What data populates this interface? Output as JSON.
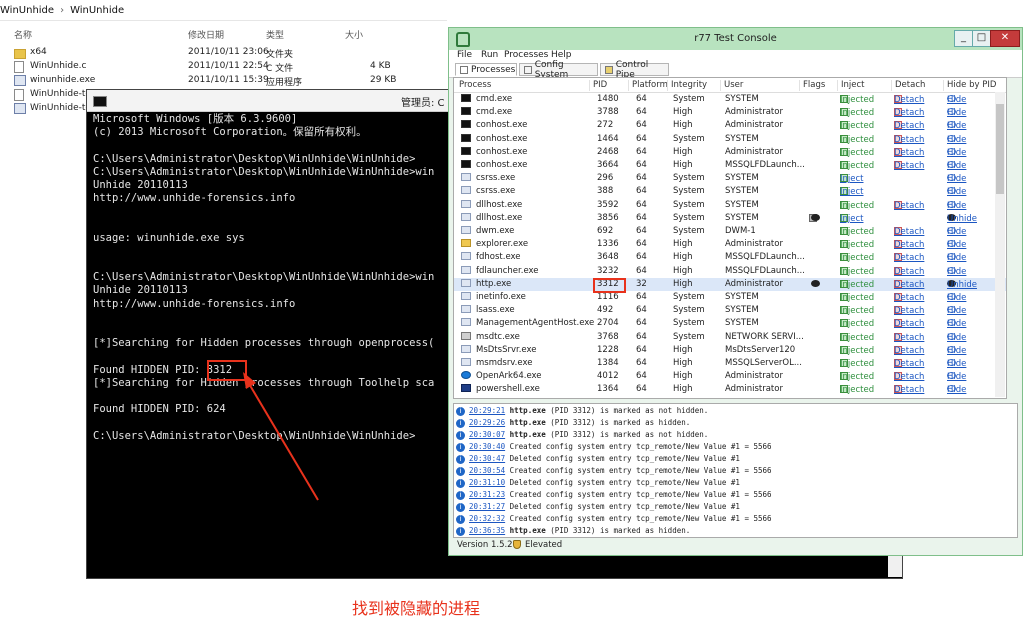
{
  "explorer": {
    "breadcrumb": [
      "WinUnhide",
      "WinUnhide"
    ],
    "columns": {
      "name": "名称",
      "modified": "修改日期",
      "type": "类型",
      "size": "大小"
    },
    "files": [
      {
        "name": "x64",
        "modified": "2011/10/11 23:06",
        "type": "文件夹",
        "size": "",
        "icon": "folder-icon"
      },
      {
        "name": "WinUnhide.c",
        "modified": "2011/10/11 22:54",
        "type": "C 文件",
        "size": "4 KB",
        "icon": "file-icon"
      },
      {
        "name": "winunhide.exe",
        "modified": "2011/10/11 15:39",
        "type": "应用程序",
        "size": "29 KB",
        "icon": "exe-icon"
      },
      {
        "name": "WinUnhide-tcp",
        "modified": "",
        "type": "",
        "size": "",
        "icon": "file-icon"
      },
      {
        "name": "WinUnhide-tcp",
        "modified": "",
        "type": "",
        "size": "",
        "icon": "exe-icon"
      }
    ]
  },
  "cmd": {
    "title": "管理员: C",
    "lines": [
      "Microsoft Windows [版本 6.3.9600]",
      "(c) 2013 Microsoft Corporation。保留所有权利。",
      "",
      "C:\\Users\\Administrator\\Desktop\\WinUnhide\\WinUnhide>",
      "C:\\Users\\Administrator\\Desktop\\WinUnhide\\WinUnhide>win",
      "Unhide 20110113",
      "http://www.unhide-forensics.info",
      "",
      "",
      "usage: winunhide.exe sys",
      "",
      "",
      "C:\\Users\\Administrator\\Desktop\\WinUnhide\\WinUnhide>win",
      "Unhide 20110113",
      "http://www.unhide-forensics.info",
      "",
      "",
      "[*]Searching for Hidden processes through openprocess(",
      "",
      "Found HIDDEN PID: 3312",
      "[*]Searching for Hidden processes through Toolhelp sca",
      "",
      "Found HIDDEN PID: 624",
      "",
      "C:\\Users\\Administrator\\Desktop\\WinUnhide\\WinUnhide>"
    ],
    "annotation": "找到被隐藏的进程"
  },
  "r77": {
    "title": "r77 Test Console",
    "controls": {
      "minimize": "_",
      "maximize": "□",
      "close": "✕"
    },
    "menu": [
      "File",
      "Run",
      "Processes",
      "Help"
    ],
    "tabs": [
      "Processes",
      "Config System",
      "Control Pipe"
    ],
    "columns": {
      "process": "Process",
      "pid": "PID",
      "platform": "Platform",
      "integrity": "Integrity",
      "user": "User",
      "flags": "Flags",
      "inject": "Inject",
      "detach": "Detach",
      "hide": "Hide by PID"
    },
    "processes": [
      {
        "name": "cmd.exe",
        "pid": "1480",
        "platform": "64",
        "integrity": "System",
        "user": "SYSTEM",
        "inject": "Injected",
        "detach": "Detach",
        "hide": "Hide",
        "icon": "cmd"
      },
      {
        "name": "cmd.exe",
        "pid": "3788",
        "platform": "64",
        "integrity": "High",
        "user": "Administrator",
        "inject": "Injected",
        "detach": "Detach",
        "hide": "Hide",
        "icon": "cmd"
      },
      {
        "name": "conhost.exe",
        "pid": "272",
        "platform": "64",
        "integrity": "High",
        "user": "Administrator",
        "inject": "Injected",
        "detach": "Detach",
        "hide": "Hide",
        "icon": "cmd"
      },
      {
        "name": "conhost.exe",
        "pid": "1464",
        "platform": "64",
        "integrity": "System",
        "user": "SYSTEM",
        "inject": "Injected",
        "detach": "Detach",
        "hide": "Hide",
        "icon": "cmd"
      },
      {
        "name": "conhost.exe",
        "pid": "2468",
        "platform": "64",
        "integrity": "High",
        "user": "Administrator",
        "inject": "Injected",
        "detach": "Detach",
        "hide": "Hide",
        "icon": "cmd"
      },
      {
        "name": "conhost.exe",
        "pid": "3664",
        "platform": "64",
        "integrity": "High",
        "user": "MSSQLFDLaunch...",
        "inject": "Injected",
        "detach": "Detach",
        "hide": "Hide",
        "icon": "cmd"
      },
      {
        "name": "csrss.exe",
        "pid": "296",
        "platform": "64",
        "integrity": "System",
        "user": "SYSTEM",
        "inject": "Inject",
        "detach": "",
        "hide": "Hide",
        "icon": "gen"
      },
      {
        "name": "csrss.exe",
        "pid": "388",
        "platform": "64",
        "integrity": "System",
        "user": "SYSTEM",
        "inject": "Inject",
        "detach": "",
        "hide": "Hide",
        "icon": "gen"
      },
      {
        "name": "dllhost.exe",
        "pid": "3592",
        "platform": "64",
        "integrity": "System",
        "user": "SYSTEM",
        "inject": "Injected",
        "detach": "Detach",
        "hide": "Hide",
        "icon": "gen"
      },
      {
        "name": "dllhost.exe",
        "pid": "3856",
        "platform": "64",
        "integrity": "System",
        "user": "SYSTEM",
        "inject": "Inject",
        "detach": "",
        "hide": "Unhide",
        "icon": "gen",
        "flags": true
      },
      {
        "name": "dwm.exe",
        "pid": "692",
        "platform": "64",
        "integrity": "System",
        "user": "DWM-1",
        "inject": "Injected",
        "detach": "Detach",
        "hide": "Hide",
        "icon": "gen"
      },
      {
        "name": "explorer.exe",
        "pid": "1336",
        "platform": "64",
        "integrity": "High",
        "user": "Administrator",
        "inject": "Injected",
        "detach": "Detach",
        "hide": "Hide",
        "icon": "exp"
      },
      {
        "name": "fdhost.exe",
        "pid": "3648",
        "platform": "64",
        "integrity": "High",
        "user": "MSSQLFDLaunch...",
        "inject": "Injected",
        "detach": "Detach",
        "hide": "Hide",
        "icon": "gen"
      },
      {
        "name": "fdlauncher.exe",
        "pid": "3232",
        "platform": "64",
        "integrity": "High",
        "user": "MSSQLFDLaunch...",
        "inject": "Injected",
        "detach": "Detach",
        "hide": "Hide",
        "icon": "gen"
      },
      {
        "name": "http.exe",
        "pid": "3312",
        "platform": "32",
        "integrity": "High",
        "user": "Administrator",
        "inject": "Injected",
        "detach": "Detach",
        "hide": "Unhide",
        "icon": "gen",
        "flags": true,
        "selected": true
      },
      {
        "name": "inetinfo.exe",
        "pid": "1116",
        "platform": "64",
        "integrity": "System",
        "user": "SYSTEM",
        "inject": "Injected",
        "detach": "Detach",
        "hide": "Hide",
        "icon": "gen"
      },
      {
        "name": "lsass.exe",
        "pid": "492",
        "platform": "64",
        "integrity": "System",
        "user": "SYSTEM",
        "inject": "Injected",
        "detach": "Detach",
        "hide": "Hide",
        "icon": "gen"
      },
      {
        "name": "ManagementAgentHost.exe",
        "pid": "2704",
        "platform": "64",
        "integrity": "System",
        "user": "SYSTEM",
        "inject": "Injected",
        "detach": "Detach",
        "hide": "Hide",
        "icon": "gen"
      },
      {
        "name": "msdtc.exe",
        "pid": "3768",
        "platform": "64",
        "integrity": "System",
        "user": "NETWORK SERVI...",
        "inject": "Injected",
        "detach": "Detach",
        "hide": "Hide",
        "icon": "dtc"
      },
      {
        "name": "MsDtsSrvr.exe",
        "pid": "1228",
        "platform": "64",
        "integrity": "High",
        "user": "MsDtsServer120",
        "inject": "Injected",
        "detach": "Detach",
        "hide": "Hide",
        "icon": "gen"
      },
      {
        "name": "msmdsrv.exe",
        "pid": "1384",
        "platform": "64",
        "integrity": "High",
        "user": "MSSQLServerOL...",
        "inject": "Injected",
        "detach": "Detach",
        "hide": "Hide",
        "icon": "gen"
      },
      {
        "name": "OpenArk64.exe",
        "pid": "4012",
        "platform": "64",
        "integrity": "High",
        "user": "Administrator",
        "inject": "Injected",
        "detach": "Detach",
        "hide": "Hide",
        "icon": "oa"
      },
      {
        "name": "powershell.exe",
        "pid": "1364",
        "platform": "64",
        "integrity": "High",
        "user": "Administrator",
        "inject": "Injected",
        "detach": "Detach",
        "hide": "Hide",
        "icon": "ps"
      }
    ],
    "log": [
      {
        "time": "20:29:21",
        "bold": "http.exe",
        "text": " (PID 3312) is marked as not hidden."
      },
      {
        "time": "20:29:26",
        "bold": "http.exe",
        "text": " (PID 3312) is marked as hidden."
      },
      {
        "time": "20:30:07",
        "bold": "http.exe",
        "text": " (PID 3312) is marked as not hidden."
      },
      {
        "time": "20:30:40",
        "bold": "",
        "text": "Created config system entry tcp_remote/New Value #1 = 5566"
      },
      {
        "time": "20:30:47",
        "bold": "",
        "text": "Deleted config system entry tcp_remote/New Value #1"
      },
      {
        "time": "20:30:54",
        "bold": "",
        "text": "Created config system entry tcp_remote/New Value #1 = 5566"
      },
      {
        "time": "20:31:10",
        "bold": "",
        "text": "Deleted config system entry tcp_remote/New Value #1"
      },
      {
        "time": "20:31:23",
        "bold": "",
        "text": "Created config system entry tcp_remote/New Value #1 = 5566"
      },
      {
        "time": "20:31:27",
        "bold": "",
        "text": "Deleted config system entry tcp_remote/New Value #1"
      },
      {
        "time": "20:32:32",
        "bold": "",
        "text": "Created config system entry tcp_remote/New Value #1 = 5566"
      },
      {
        "time": "20:36:35",
        "bold": "http.exe",
        "text": " (PID 3312) is marked as hidden."
      }
    ],
    "status": {
      "version": "Version 1.5.2",
      "elevated": "Elevated"
    }
  }
}
